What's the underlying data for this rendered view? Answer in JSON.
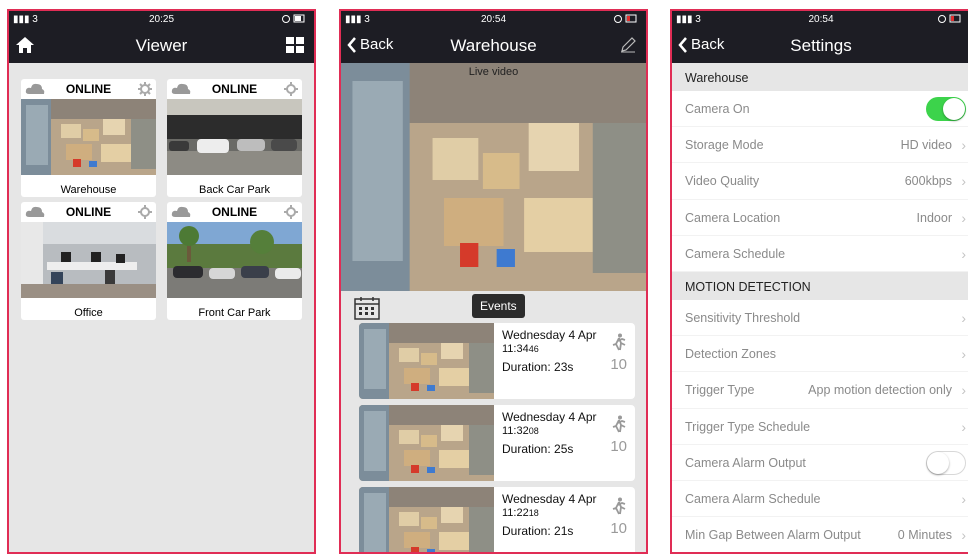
{
  "status_bars": [
    {
      "left": "▮▮▮ 3 ",
      "time": "20:25"
    },
    {
      "left": "▮▮▮ 3 ",
      "time": "20:54"
    },
    {
      "left": "▮▮▮ 3 ",
      "time": "20:54"
    }
  ],
  "viewer": {
    "title": "Viewer",
    "cameras": [
      {
        "status": "ONLINE",
        "name": "Warehouse"
      },
      {
        "status": "ONLINE",
        "name": "Back Car Park"
      },
      {
        "status": "ONLINE",
        "name": "Office"
      },
      {
        "status": "ONLINE",
        "name": "Front Car Park"
      }
    ]
  },
  "warehouse": {
    "back_label": "Back",
    "title": "Warehouse",
    "video_label": "Live video",
    "events_label": "Events",
    "events": [
      {
        "day": "Wednesday 4 Apr",
        "time_main": "11:34",
        "time_sec": "46",
        "duration": "Duration: 23s",
        "count": "10"
      },
      {
        "day": "Wednesday 4 Apr",
        "time_main": "11:32",
        "time_sec": "08",
        "duration": "Duration: 25s",
        "count": "10"
      },
      {
        "day": "Wednesday 4 Apr",
        "time_main": "11:22",
        "time_sec": "18",
        "duration": "Duration: 21s",
        "count": "10"
      }
    ]
  },
  "settings": {
    "back_label": "Back",
    "title": "Settings",
    "section1": "Warehouse",
    "camera_on": {
      "label": "Camera On",
      "on": true
    },
    "rows1": [
      {
        "label": "Storage Mode",
        "value": "HD video"
      },
      {
        "label": "Video Quality",
        "value": "600kbps"
      },
      {
        "label": "Camera Location",
        "value": "Indoor"
      },
      {
        "label": "Camera Schedule",
        "value": ""
      }
    ],
    "section2": "MOTION DETECTION",
    "rows2": [
      {
        "label": "Sensitivity Threshold",
        "value": ""
      },
      {
        "label": "Detection Zones",
        "value": ""
      },
      {
        "label": "Trigger Type",
        "value": "App motion detection only"
      },
      {
        "label": "Trigger Type Schedule",
        "value": ""
      }
    ],
    "alarm_output": {
      "label": "Camera Alarm Output",
      "on": false
    },
    "rows3": [
      {
        "label": "Camera Alarm Schedule",
        "value": ""
      },
      {
        "label": "Min Gap Between Alarm Output",
        "value": "0 Minutes"
      }
    ]
  },
  "colors": {
    "navbar": "#1d1d24",
    "frame": "#e02d55",
    "toggle_on": "#3cd34b",
    "background": "#e6e6e6"
  }
}
